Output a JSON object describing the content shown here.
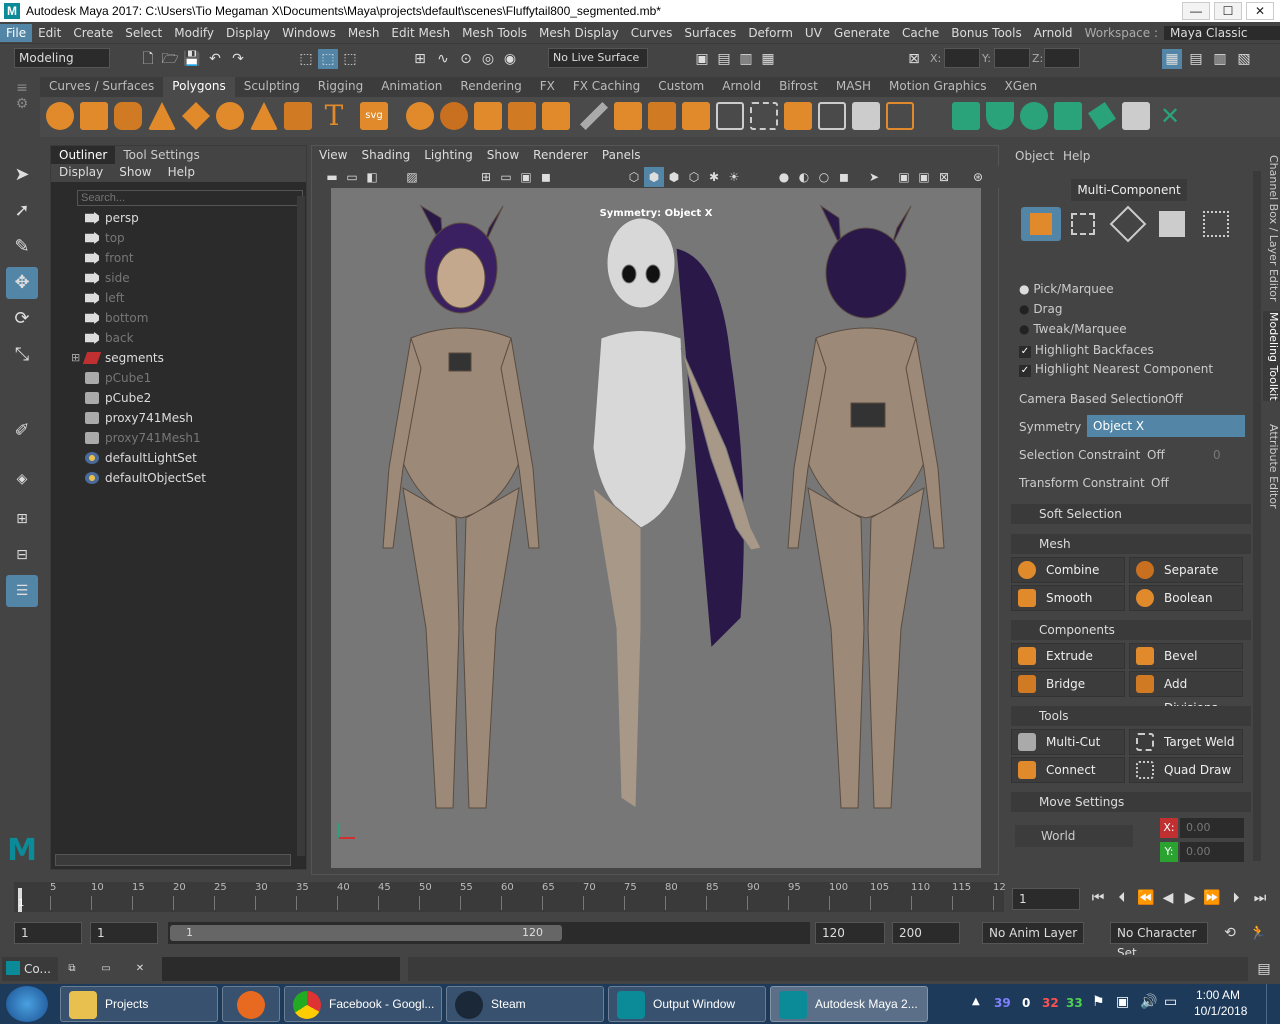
{
  "window": {
    "title": "Autodesk Maya 2017: C:\\Users\\Tio Megaman X\\Documents\\Maya\\projects\\default\\scenes\\Fluffytail800_segmented.mb*",
    "min": "—",
    "max": "☐",
    "close": "✕"
  },
  "menus": [
    "File",
    "Edit",
    "Create",
    "Select",
    "Modify",
    "Display",
    "Windows",
    "Mesh",
    "Edit Mesh",
    "Mesh Tools",
    "Mesh Display",
    "Curves",
    "Surfaces",
    "Deform",
    "UV",
    "Generate",
    "Cache",
    "Bonus Tools",
    "Arnold"
  ],
  "workspace": {
    "label": "Workspace :",
    "value": "Maya Classic"
  },
  "status": {
    "mode": "Modeling",
    "live_surface": "No Live Surface",
    "x_label": "X:",
    "y_label": "Y:",
    "z_label": "Z:"
  },
  "shelf_tabs": [
    "Curves / Surfaces",
    "Polygons",
    "Sculpting",
    "Rigging",
    "Animation",
    "Rendering",
    "FX",
    "FX Caching",
    "Custom",
    "Arnold",
    "Bifrost",
    "MASH",
    "Motion Graphics",
    "XGen"
  ],
  "outliner": {
    "tabs": [
      "Outliner",
      "Tool Settings"
    ],
    "menu": [
      "Display",
      "Show",
      "Help"
    ],
    "search_placeholder": "Search...",
    "items": [
      {
        "label": "persp",
        "dim": false,
        "icon": "camera-icon"
      },
      {
        "label": "top",
        "dim": true,
        "icon": "camera-icon"
      },
      {
        "label": "front",
        "dim": true,
        "icon": "camera-icon"
      },
      {
        "label": "side",
        "dim": true,
        "icon": "camera-icon"
      },
      {
        "label": "left",
        "dim": true,
        "icon": "camera-icon"
      },
      {
        "label": "bottom",
        "dim": true,
        "icon": "camera-icon"
      },
      {
        "label": "back",
        "dim": true,
        "icon": "camera-icon"
      },
      {
        "label": "segments",
        "dim": false,
        "icon": "group-icon"
      },
      {
        "label": "pCube1",
        "dim": true,
        "icon": "mesh-icon"
      },
      {
        "label": "pCube2",
        "dim": false,
        "icon": "mesh-icon"
      },
      {
        "label": "proxy741Mesh",
        "dim": false,
        "icon": "mesh-icon"
      },
      {
        "label": "proxy741Mesh1",
        "dim": true,
        "icon": "mesh-icon"
      },
      {
        "label": "defaultLightSet",
        "dim": false,
        "icon": "set-icon"
      },
      {
        "label": "defaultObjectSet",
        "dim": false,
        "icon": "set-icon"
      }
    ]
  },
  "viewport": {
    "menu": [
      "View",
      "Shading",
      "Lighting",
      "Show",
      "Renderer",
      "Panels"
    ],
    "symmetry_hud": "Symmetry: Object X"
  },
  "modeling_toolkit": {
    "menu": [
      "Object",
      "Help"
    ],
    "mode": "Multi-Component",
    "options": [
      "Pick/Marquee",
      "Drag",
      "Tweak/Marquee"
    ],
    "checks": [
      "Highlight Backfaces",
      "Highlight Nearest Component"
    ],
    "camera_sel": {
      "label": "Camera Based Selection",
      "value": "Off"
    },
    "symmetry": {
      "label": "Symmetry",
      "value": "Object X"
    },
    "sel_constraint": {
      "label": "Selection Constraint",
      "value": "Off",
      "num": "0"
    },
    "xform_constraint": {
      "label": "Transform Constraint",
      "value": "Off"
    },
    "soft_selection": "Soft Selection",
    "mesh_header": "Mesh",
    "mesh_buttons": [
      "Combine",
      "Separate",
      "Smooth",
      "Boolean"
    ],
    "components_header": "Components",
    "component_buttons": [
      "Extrude",
      "Bevel",
      "Bridge",
      "Add Divisions"
    ],
    "tools_header": "Tools",
    "tool_buttons": [
      "Multi-Cut",
      "Target Weld",
      "Connect",
      "Quad Draw"
    ],
    "move_settings": "Move Settings",
    "world": "World",
    "x_label": "X:",
    "x_val": "0.00",
    "y_label": "Y:",
    "y_val": "0.00"
  },
  "side_tabs": [
    "Channel Box / Layer Editor",
    "Modeling Toolkit",
    "Attribute Editor"
  ],
  "timeline": {
    "ticks": [
      "5",
      "10",
      "15",
      "20",
      "25",
      "30",
      "35",
      "40",
      "45",
      "50",
      "55",
      "60",
      "65",
      "70",
      "75",
      "80",
      "85",
      "90",
      "95",
      "100",
      "105",
      "110",
      "115",
      "12"
    ],
    "current_frame": "1",
    "start_marker": "1"
  },
  "range": {
    "start": "1",
    "playback_start": "1",
    "slider_start": "1",
    "slider_end": "120",
    "playback_end": "120",
    "end": "200",
    "anim_layer": "No Anim Layer",
    "char_set": "No Character Set"
  },
  "cmdline": {
    "label": "Co..."
  },
  "taskbar": {
    "items": [
      "Projects",
      "",
      "Facebook - Googl...",
      "Steam",
      "Output Window",
      "Autodesk Maya 2..."
    ],
    "tray": {
      "n1": "39",
      "n2": "0",
      "n3": "32",
      "n4": "33",
      "time": "1:00 AM",
      "date": "10/1/2018"
    }
  },
  "colors": {
    "accent": "#5285a6",
    "orange": "#e08a2c",
    "green": "#2aa37a",
    "skin": "#9c8978"
  }
}
